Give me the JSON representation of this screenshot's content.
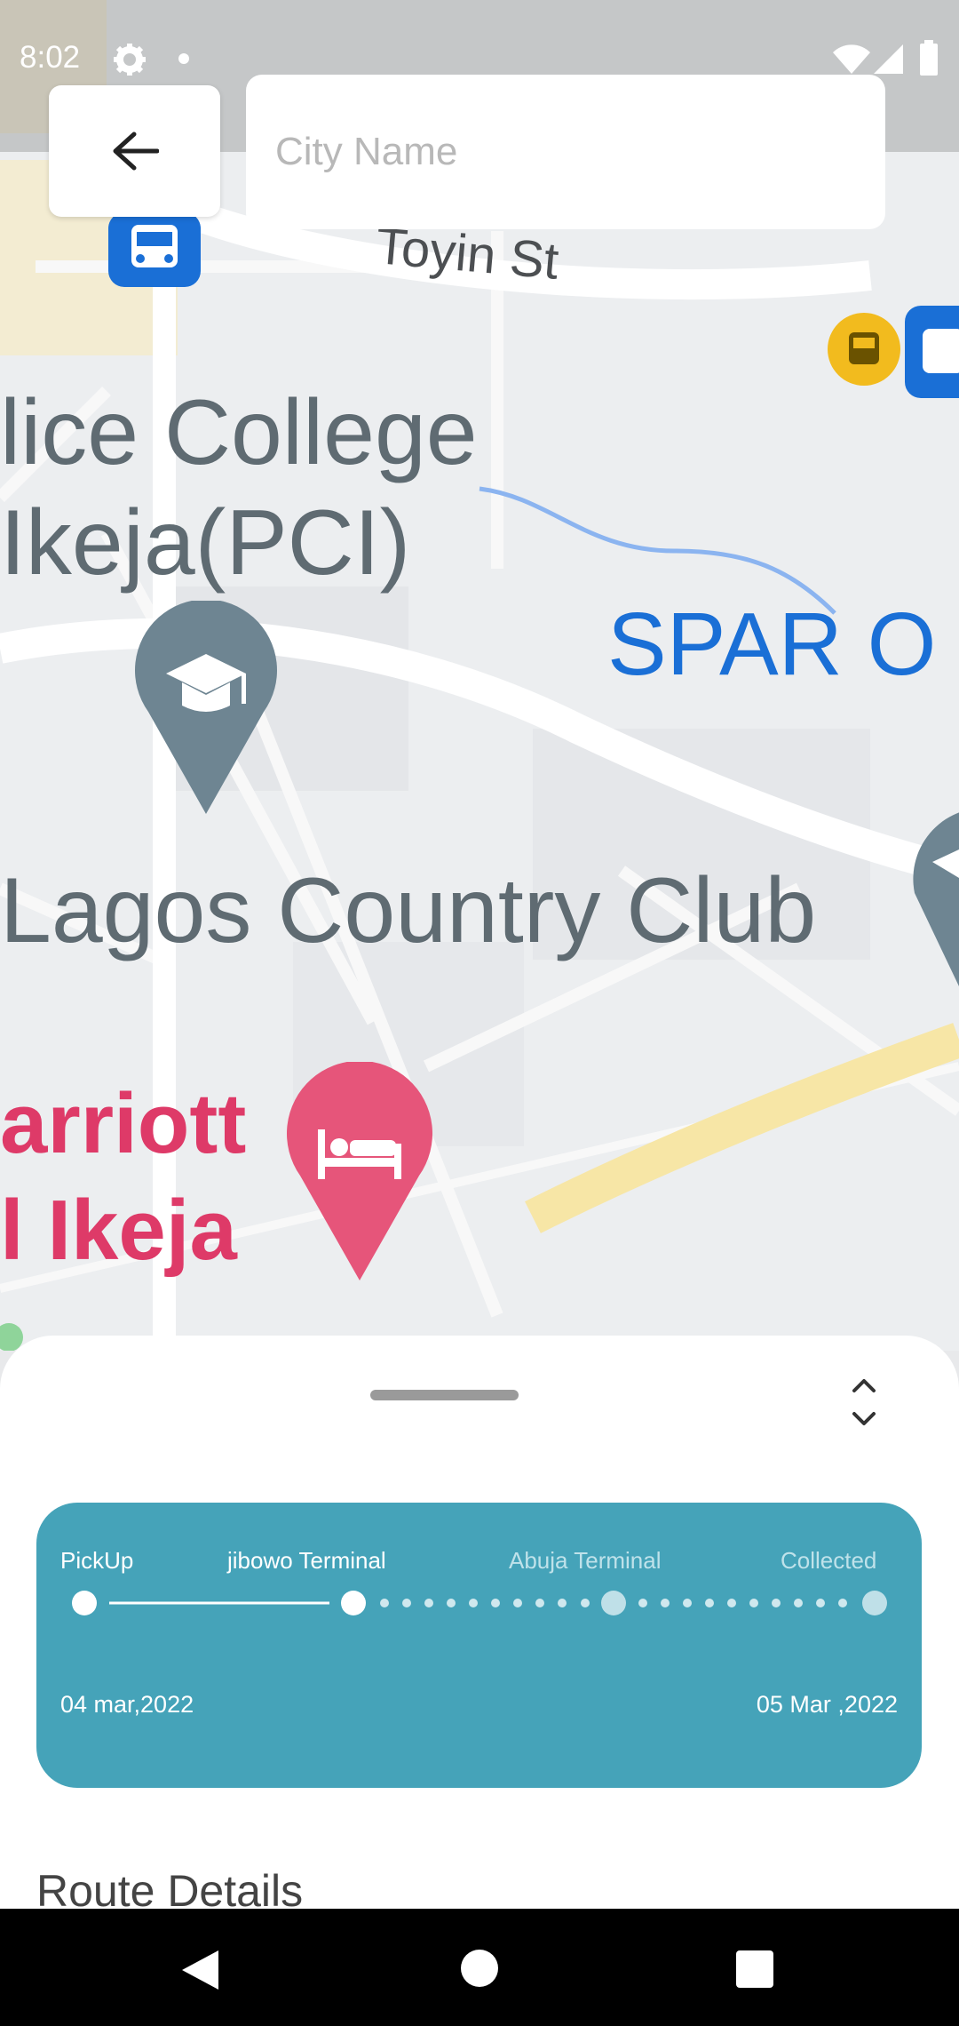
{
  "status_bar": {
    "time": "8:02"
  },
  "search": {
    "placeholder": "City Name"
  },
  "map": {
    "labels": {
      "street": "Toyin St",
      "college_line1": "lice College",
      "college_line2": "Ikeja(PCI)",
      "spar": "SPAR O",
      "club": "Lagos Country Club",
      "hotel_line1": "arriott",
      "hotel_line2": "l Ikeja"
    }
  },
  "tracker": {
    "stages": [
      "PickUp",
      "jibowo Terminal",
      "Abuja Terminal",
      "Collected"
    ],
    "start_date": "04 mar,2022",
    "end_date": "05 Mar ,2022"
  },
  "section": {
    "route_details": "Route Details"
  },
  "colors": {
    "card": "#45a3b9",
    "hotel_pin": "#e6557a",
    "poi_pin": "#6e8592",
    "transit": "#1a6fd6",
    "spar": "#1a6fd6"
  }
}
